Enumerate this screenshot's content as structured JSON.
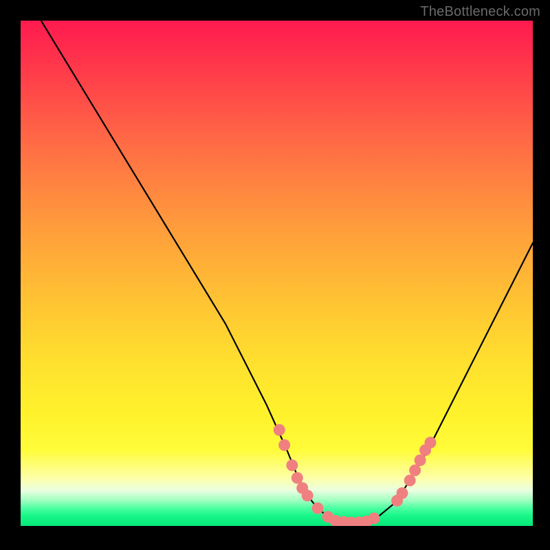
{
  "watermark": "TheBottleneck.com",
  "chart_data": {
    "type": "line",
    "title": "",
    "xlabel": "",
    "ylabel": "",
    "xlim": [
      0,
      100
    ],
    "ylim": [
      0,
      100
    ],
    "series": [
      {
        "name": "bottleneck-curve",
        "x": [
          4,
          10,
          16,
          22,
          28,
          34,
          40,
          44,
          48,
          52,
          54,
          56,
          58,
          60,
          62,
          64,
          66,
          68,
          70,
          73,
          76,
          80,
          84,
          88,
          92,
          96,
          100
        ],
        "values": [
          100,
          90,
          80,
          70,
          60,
          50,
          40,
          32,
          24,
          15,
          10,
          6,
          3.5,
          1.8,
          1.0,
          0.7,
          0.7,
          1.0,
          2.0,
          4.5,
          9,
          16,
          24,
          32,
          40,
          48,
          56
        ]
      }
    ],
    "markers": {
      "name": "highlight-dots",
      "color": "#f08080",
      "points": [
        {
          "x": 50.5,
          "y": 19
        },
        {
          "x": 51.5,
          "y": 16
        },
        {
          "x": 53.0,
          "y": 12
        },
        {
          "x": 54.0,
          "y": 9.5
        },
        {
          "x": 55.0,
          "y": 7.5
        },
        {
          "x": 56.0,
          "y": 6.0
        },
        {
          "x": 58.0,
          "y": 3.5
        },
        {
          "x": 60.0,
          "y": 1.8
        },
        {
          "x": 61.5,
          "y": 1.0
        },
        {
          "x": 63.0,
          "y": 0.8
        },
        {
          "x": 64.5,
          "y": 0.7
        },
        {
          "x": 66.0,
          "y": 0.7
        },
        {
          "x": 67.5,
          "y": 0.9
        },
        {
          "x": 69.0,
          "y": 1.5
        },
        {
          "x": 73.5,
          "y": 5.0
        },
        {
          "x": 74.5,
          "y": 6.5
        },
        {
          "x": 76.0,
          "y": 9.0
        },
        {
          "x": 77.0,
          "y": 11.0
        },
        {
          "x": 78.0,
          "y": 13.0
        },
        {
          "x": 79.0,
          "y": 15.0
        },
        {
          "x": 80.0,
          "y": 16.5
        }
      ]
    }
  }
}
